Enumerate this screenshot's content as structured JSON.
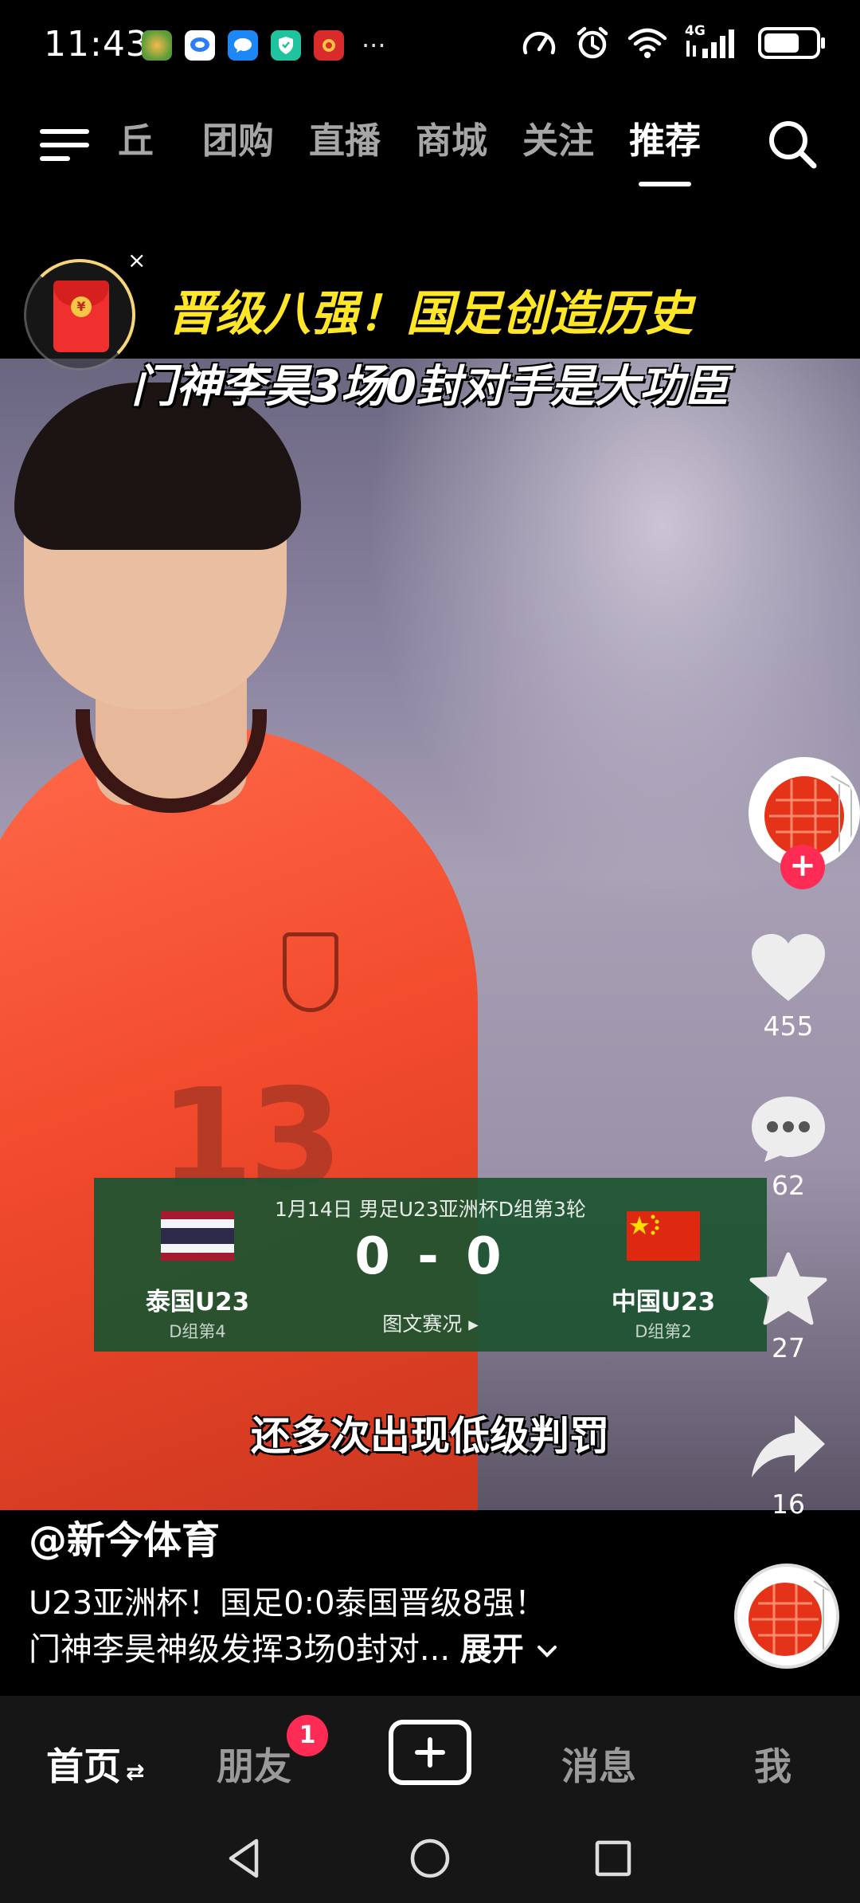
{
  "status_bar": {
    "time": "11:43",
    "more": "···",
    "network": "4G",
    "battery_level": 0.7,
    "notification_icons": [
      "app-icon-1",
      "message-bubble-icon",
      "chat-icon",
      "shield-icon",
      "app-icon-5"
    ]
  },
  "top_nav": {
    "tabs": [
      {
        "label": "丘",
        "active": false
      },
      {
        "label": "团购",
        "active": false
      },
      {
        "label": "直播",
        "active": false
      },
      {
        "label": "商城",
        "active": false
      },
      {
        "label": "关注",
        "active": false
      },
      {
        "label": "推荐",
        "active": true
      }
    ]
  },
  "video": {
    "title_line1": "晋级八强！国足创造历史",
    "title_line2": "门神李昊3场0封对手是大功臣",
    "subtitle": "还多次出现低级判罚",
    "jersey_number": "13",
    "red_packet_close": "×",
    "red_packet_coin": "¥"
  },
  "score_card": {
    "meta": "1月14日  男足U23亚洲杯D组第3轮",
    "score": "0 - 0",
    "link": "图文赛况 ▸",
    "home": {
      "name": "泰国U23",
      "rank": "D组第4"
    },
    "away": {
      "name": "中国U23",
      "rank": "D组第2"
    }
  },
  "actions": {
    "follow": "+",
    "likes": "455",
    "comments": "62",
    "favorites": "27",
    "shares": "16"
  },
  "caption": {
    "author": "@新今体育",
    "line1": "U23亚洲杯！国足0:0泰国晋级8强！",
    "line2": "门神李昊神级发挥3场0封对...",
    "expand": "展开"
  },
  "tabbar": {
    "home": "首页",
    "home_switch": "⇄",
    "friends": "朋友",
    "friends_badge": "1",
    "messages": "消息",
    "me": "我"
  },
  "colors": {
    "accent": "#fe2c55",
    "title_yellow": "#ffe629",
    "score_card_green": "#1c5430"
  }
}
